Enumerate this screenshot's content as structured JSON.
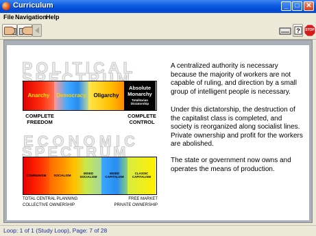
{
  "window": {
    "title": "Curriculum"
  },
  "menu": {
    "file": "File",
    "navigation": "Navigation",
    "help": "Help"
  },
  "toolbar": {
    "stop_label": "STOP"
  },
  "graphic": {
    "political_title_1": "POLITICAL",
    "political_title_2": "SPECTRUM",
    "political_segments": [
      {
        "label": "Anarchy",
        "color": "#ffe000"
      },
      {
        "label": "Democracy",
        "color": "#ffd000"
      },
      {
        "label": "Oligarchy",
        "color": "#000000"
      },
      {
        "label": "Absolute Monarchy",
        "sub": "Totalitarian Dictatorship",
        "color": "#ffffff"
      }
    ],
    "left_caption_1": "COMPLETE",
    "left_caption_2": "FREEDOM",
    "right_caption_1": "COMPLETE",
    "right_caption_2": "CONTROL",
    "economic_title_1": "ECONOMIC",
    "economic_title_2": "SPECTRUM",
    "economic_segments": [
      {
        "label": "COMMUNISM"
      },
      {
        "label": "SOCIALISM"
      },
      {
        "label": "MIXED SOCIALISM"
      },
      {
        "label": "MIXED CAPITALISM"
      },
      {
        "label": "CLASSIC CAPITALISM"
      }
    ],
    "econ_left_1": "TOTAL CENTRAL PLANNING",
    "econ_left_2": "COLLECTIVE OWNERSHIP",
    "econ_right_1": "FREE MARKET",
    "econ_right_2": "PRIVATE OWNERSHIP"
  },
  "text": {
    "p1": "A centralized authority is necessary because the majority of workers are not capable of ruling, and direction by a small group of intelligent people is necessary.",
    "p2": "Under this dictatorship, the destruction of the capitalist class is completed, and society is reorganized along socialist lines. Private ownership and profit for the workers are abolished.",
    "p3": "The state or government now owns and operates the means of production."
  },
  "status": {
    "text": "Loop: 1 of 1 (Study Loop),  Page: 7 of 28"
  }
}
